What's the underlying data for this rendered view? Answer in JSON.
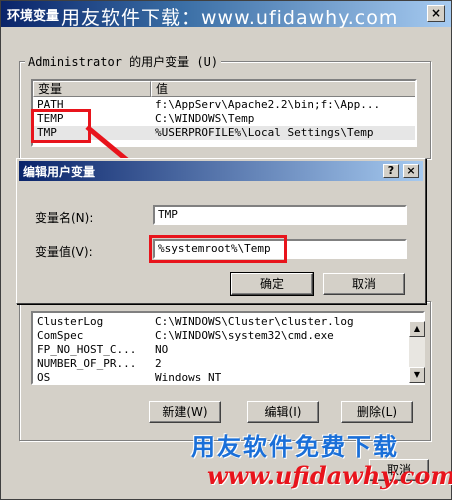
{
  "window": {
    "title": "环境变量",
    "watermark_top": "用友软件下载：www.ufidawhy.com",
    "close_glyph": "×"
  },
  "user_vars": {
    "group_label": "Administrator 的用户变量 (U)",
    "columns": [
      "变量",
      "值"
    ],
    "rows": [
      {
        "name": "PATH",
        "value": "f:\\AppServ\\Apache2.2\\bin;f:\\App..."
      },
      {
        "name": "TEMP",
        "value": "C:\\WINDOWS\\Temp"
      },
      {
        "name": "TMP",
        "value": "%USERPROFILE%\\Local Settings\\Temp"
      }
    ]
  },
  "dialog": {
    "title": "编辑用户变量",
    "help_glyph": "?",
    "close_glyph": "×",
    "name_label": "变量名(N):",
    "name_value": "TMP",
    "value_label": "变量值(V):",
    "value_value": "%systemroot%\\Temp",
    "ok_label": "确定",
    "cancel_label": "取消"
  },
  "system_vars": {
    "rows": [
      {
        "name": "ClusterLog",
        "value": "C:\\WINDOWS\\Cluster\\cluster.log"
      },
      {
        "name": "ComSpec",
        "value": "C:\\WINDOWS\\system32\\cmd.exe"
      },
      {
        "name": "FP_NO_HOST_C...",
        "value": "NO"
      },
      {
        "name": "NUMBER_OF_PR...",
        "value": "2"
      },
      {
        "name": "OS",
        "value": "Windows NT"
      }
    ],
    "new_label": "新建(W)",
    "edit_label": "编辑(I)",
    "delete_label": "删除(L)"
  },
  "footer": {
    "brand_text": "用友软件免费下载",
    "brand_url": "www.ufidawhy.com",
    "partial_button": "取消"
  },
  "colors": {
    "highlight_red": "#e8141c",
    "title_blue": "#0a246a"
  }
}
